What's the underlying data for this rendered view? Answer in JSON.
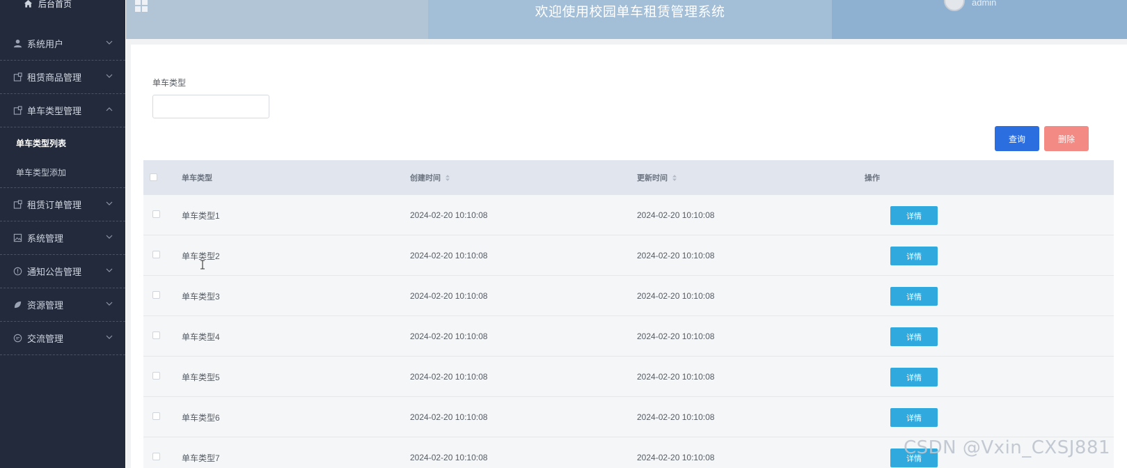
{
  "sidebar": {
    "home_label": "后台首页",
    "menus": [
      {
        "label": "系统用户",
        "icon": "user-icon"
      },
      {
        "label": "租赁商品管理",
        "icon": "tag-icon"
      },
      {
        "label": "单车类型管理",
        "icon": "tag-icon"
      },
      {
        "label": "租赁订单管理",
        "icon": "tag-icon"
      },
      {
        "label": "系统管理",
        "icon": "image-icon"
      },
      {
        "label": "通知公告管理",
        "icon": "info-icon"
      },
      {
        "label": "资源管理",
        "icon": "leaf-icon"
      },
      {
        "label": "交流管理",
        "icon": "chat-icon"
      }
    ],
    "submenu": [
      {
        "label": "单车类型列表",
        "active": true
      },
      {
        "label": "单车类型添加",
        "active": false
      }
    ]
  },
  "header": {
    "title": "欢迎使用校园单车租赁管理系统",
    "username": "admin"
  },
  "search": {
    "label": "单车类型",
    "value": "",
    "query_button": "查询",
    "delete_button": "删除"
  },
  "table": {
    "columns": [
      "单车类型",
      "创建时间",
      "更新时间",
      "操作"
    ],
    "rows": [
      {
        "type": "单车类型1",
        "created": "2024-02-20 10:10:08",
        "updated": "2024-02-20 10:10:08",
        "action": "详情"
      },
      {
        "type": "单车类型2",
        "created": "2024-02-20 10:10:08",
        "updated": "2024-02-20 10:10:08",
        "action": "详情"
      },
      {
        "type": "单车类型3",
        "created": "2024-02-20 10:10:08",
        "updated": "2024-02-20 10:10:08",
        "action": "详情"
      },
      {
        "type": "单车类型4",
        "created": "2024-02-20 10:10:08",
        "updated": "2024-02-20 10:10:08",
        "action": "详情"
      },
      {
        "type": "单车类型5",
        "created": "2024-02-20 10:10:08",
        "updated": "2024-02-20 10:10:08",
        "action": "详情"
      },
      {
        "type": "单车类型6",
        "created": "2024-02-20 10:10:08",
        "updated": "2024-02-20 10:10:08",
        "action": "详情"
      },
      {
        "type": "单车类型7",
        "created": "2024-02-20 10:10:08",
        "updated": "2024-02-20 10:10:08",
        "action": "详情"
      }
    ]
  },
  "watermark": "CSDN @Vxin_CXSJ881",
  "colors": {
    "sidebar_bg": "#232a3b",
    "header_bg": "#a3bfd8",
    "primary_button": "#2b6ee0",
    "danger_button": "#f48a84",
    "detail_button": "#2fa9de"
  }
}
